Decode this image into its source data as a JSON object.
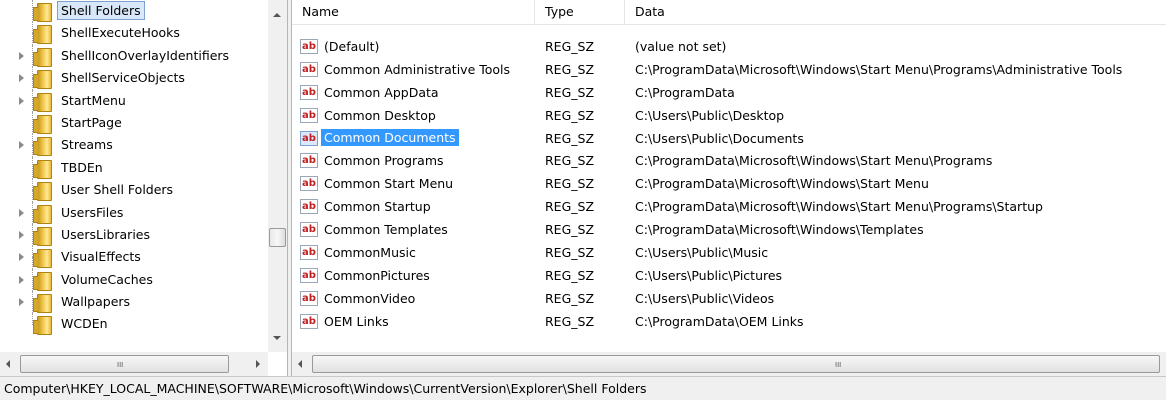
{
  "tree": {
    "items": [
      {
        "label": "Shell Folders",
        "expandable": false,
        "selected": true
      },
      {
        "label": "ShellExecuteHooks",
        "expandable": false
      },
      {
        "label": "ShellIconOverlayIdentifiers",
        "expandable": true
      },
      {
        "label": "ShellServiceObjects",
        "expandable": true
      },
      {
        "label": "StartMenu",
        "expandable": true
      },
      {
        "label": "StartPage",
        "expandable": false
      },
      {
        "label": "Streams",
        "expandable": true
      },
      {
        "label": "TBDEn",
        "expandable": false
      },
      {
        "label": "User Shell Folders",
        "expandable": false
      },
      {
        "label": "UsersFiles",
        "expandable": true
      },
      {
        "label": "UsersLibraries",
        "expandable": true
      },
      {
        "label": "VisualEffects",
        "expandable": true
      },
      {
        "label": "VolumeCaches",
        "expandable": true
      },
      {
        "label": "Wallpapers",
        "expandable": true
      },
      {
        "label": "WCDEn",
        "expandable": false
      }
    ],
    "hscroll_grip": "III"
  },
  "values": {
    "columns": {
      "name": "Name",
      "type": "Type",
      "data": "Data"
    },
    "icon_text": "ab",
    "rows": [
      {
        "name": "(Default)",
        "type": "REG_SZ",
        "data": "(value not set)"
      },
      {
        "name": "Common Administrative Tools",
        "type": "REG_SZ",
        "data": "C:\\ProgramData\\Microsoft\\Windows\\Start Menu\\Programs\\Administrative Tools"
      },
      {
        "name": "Common AppData",
        "type": "REG_SZ",
        "data": "C:\\ProgramData"
      },
      {
        "name": "Common Desktop",
        "type": "REG_SZ",
        "data": "C:\\Users\\Public\\Desktop"
      },
      {
        "name": "Common Documents",
        "type": "REG_SZ",
        "data": "C:\\Users\\Public\\Documents",
        "selected": true
      },
      {
        "name": "Common Programs",
        "type": "REG_SZ",
        "data": "C:\\ProgramData\\Microsoft\\Windows\\Start Menu\\Programs"
      },
      {
        "name": "Common Start Menu",
        "type": "REG_SZ",
        "data": "C:\\ProgramData\\Microsoft\\Windows\\Start Menu"
      },
      {
        "name": "Common Startup",
        "type": "REG_SZ",
        "data": "C:\\ProgramData\\Microsoft\\Windows\\Start Menu\\Programs\\Startup"
      },
      {
        "name": "Common Templates",
        "type": "REG_SZ",
        "data": "C:\\ProgramData\\Microsoft\\Windows\\Templates"
      },
      {
        "name": "CommonMusic",
        "type": "REG_SZ",
        "data": "C:\\Users\\Public\\Music"
      },
      {
        "name": "CommonPictures",
        "type": "REG_SZ",
        "data": "C:\\Users\\Public\\Pictures"
      },
      {
        "name": "CommonVideo",
        "type": "REG_SZ",
        "data": "C:\\Users\\Public\\Videos"
      },
      {
        "name": "OEM Links",
        "type": "REG_SZ",
        "data": "C:\\ProgramData\\OEM Links"
      }
    ],
    "hscroll_grip": "III"
  },
  "status": {
    "path": "Computer\\HKEY_LOCAL_MACHINE\\SOFTWARE\\Microsoft\\Windows\\CurrentVersion\\Explorer\\Shell Folders"
  },
  "colors": {
    "selection_focused": "#3399ff",
    "selection_unfocused": "#d9e8f9",
    "icon_text": "#c22020"
  }
}
